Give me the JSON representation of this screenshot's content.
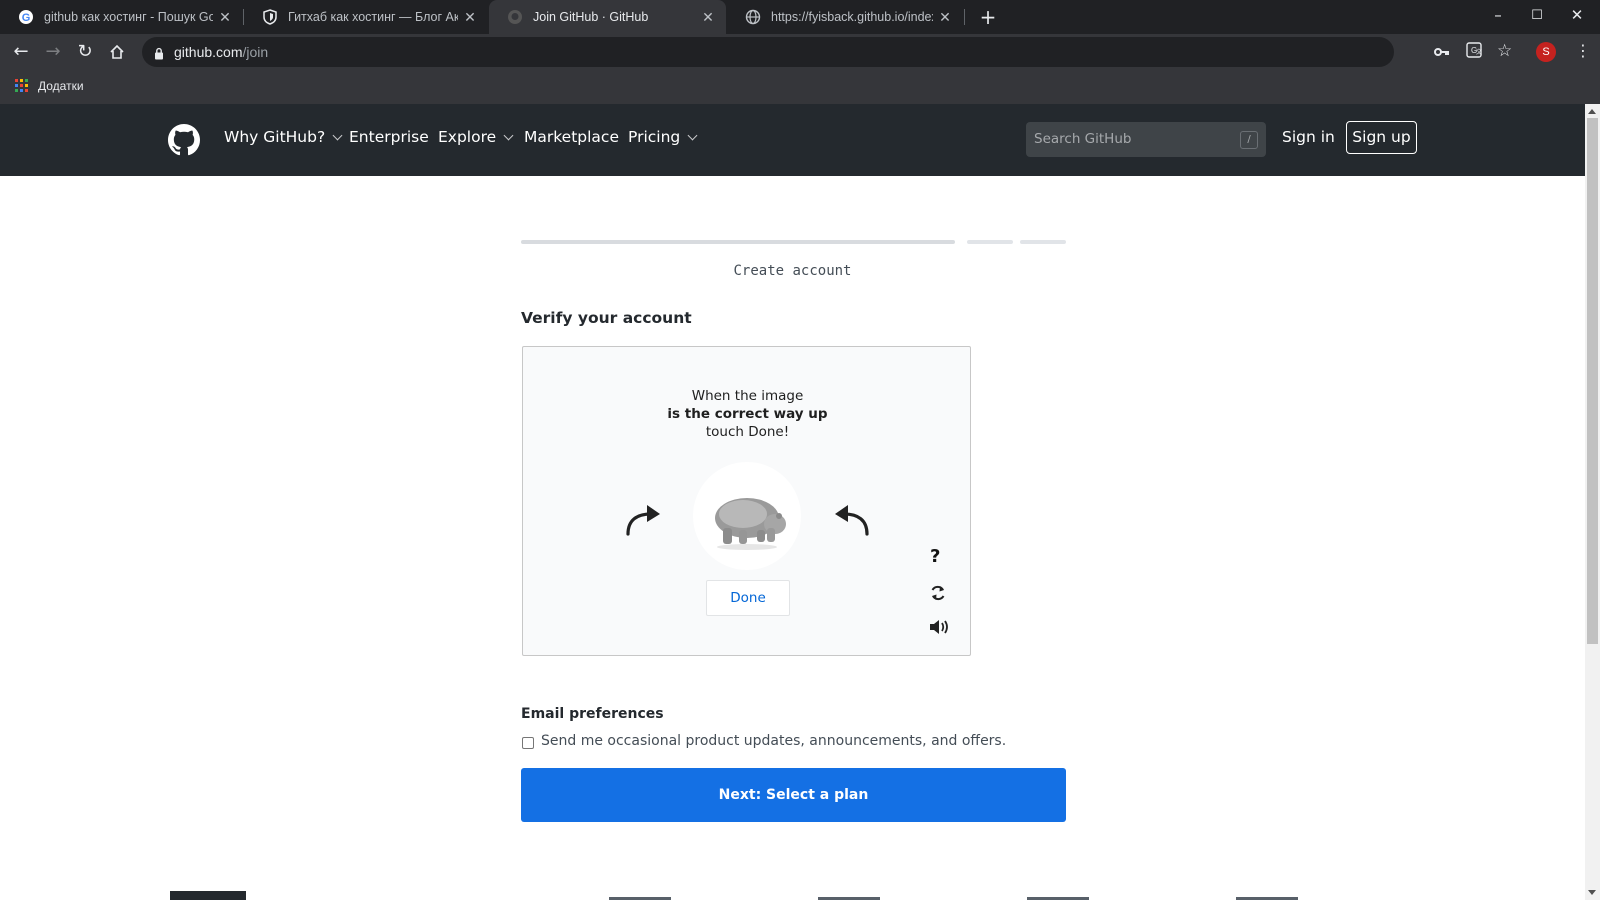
{
  "browser": {
    "tabs": [
      {
        "title": "github как хостинг - Пошук Google",
        "active": false,
        "favicon": "google-icon"
      },
      {
        "title": "Гитхаб как хостинг — Блог Академии",
        "active": false,
        "favicon": "shield-icon"
      },
      {
        "title": "Join GitHub · GitHub",
        "active": true,
        "favicon": "github-icon"
      },
      {
        "title": "https://fyisback.github.io/index.html",
        "active": false,
        "favicon": "globe-icon"
      }
    ],
    "url_host": "github.com",
    "url_path": "/join",
    "bookmarks_label": "Додатки",
    "profile_initial": "S"
  },
  "header": {
    "nav": [
      {
        "label": "Why GitHub?",
        "dropdown": true
      },
      {
        "label": "Enterprise",
        "dropdown": false
      },
      {
        "label": "Explore",
        "dropdown": true
      },
      {
        "label": "Marketplace",
        "dropdown": false
      },
      {
        "label": "Pricing",
        "dropdown": true
      }
    ],
    "search_placeholder": "Search GitHub",
    "search_shortcut": "/",
    "sign_in": "Sign in",
    "sign_up": "Sign up"
  },
  "signup": {
    "step_label": "Create account",
    "steps_total": 3,
    "current_step": 1,
    "verify_title": "Verify your account",
    "captcha": {
      "instruction_line1": "When the image",
      "instruction_line2": "is the correct way up",
      "instruction_line3": "touch Done!",
      "done_label": "Done",
      "help_label": "?"
    },
    "email_title": "Email preferences",
    "email_checkbox_label": "Send me occasional product updates, announcements, and offers.",
    "email_checked": false,
    "next_label": "Next: Select a plan"
  },
  "colors": {
    "chrome_dark": "#202124",
    "gh_header": "#24292e",
    "primary_button": "#1470e4",
    "link_blue": "#0366d6"
  }
}
